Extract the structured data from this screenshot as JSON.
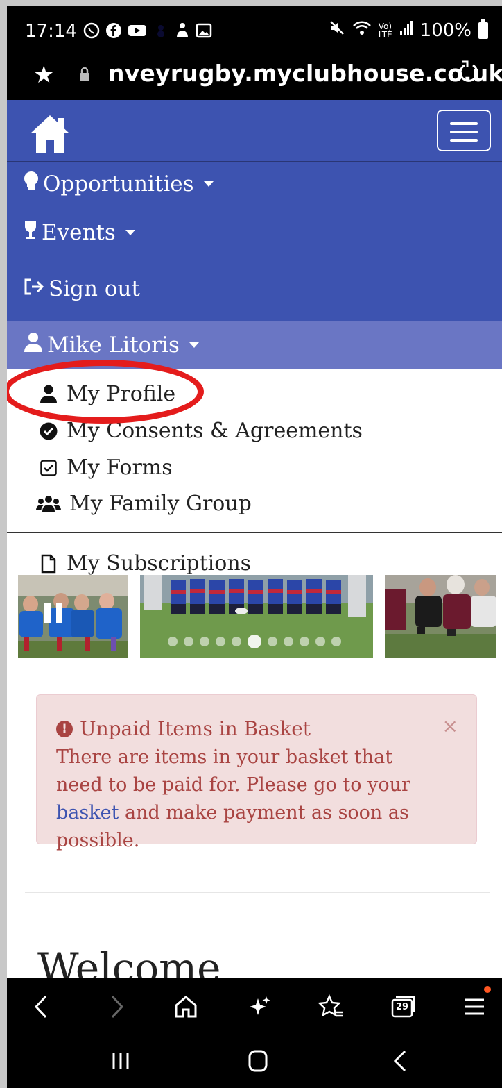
{
  "status_bar": {
    "time": "17:14",
    "icons": [
      "whatsapp-icon",
      "facebook-icon",
      "youtube-icon",
      "game-icon",
      "image-icon"
    ],
    "battery": "100%"
  },
  "browser": {
    "url": "nveyrugby.myclubhouse.co.uk",
    "tabs_count": "29"
  },
  "nav": {
    "items": [
      {
        "label": "Opportunities",
        "icon": "lightbulb-icon"
      },
      {
        "label": "Events",
        "icon": "wine-glass-icon"
      },
      {
        "label": "Sign out",
        "icon": "sign-out-icon"
      }
    ],
    "user": {
      "label": "Mike Litoris",
      "icon": "user-icon"
    },
    "dropdown": [
      {
        "label": "My Profile",
        "icon": "user-icon"
      },
      {
        "label": "My Consents & Agreements",
        "icon": "check-circle-icon"
      },
      {
        "label": "My Forms",
        "icon": "check-square-icon"
      },
      {
        "label": "My Family Group",
        "icon": "users-icon"
      },
      {
        "label": "My Subscriptions",
        "icon": "file-icon"
      }
    ]
  },
  "carousel": {
    "slide_count": 11,
    "active_index": 5
  },
  "alert": {
    "title": "Unpaid Items in Basket",
    "body_before": "There are items in your basket that need to be paid for. Please go to your ",
    "link": "basket",
    "body_after": " and make payment as soon as possible.",
    "close": "×"
  },
  "welcome": "Welcome",
  "colors": {
    "nav": "#3d53b0",
    "nav_user": "#6a76c4",
    "alert_bg": "#f2dede",
    "alert_text": "#a94442",
    "highlight": "#e41c1c"
  }
}
